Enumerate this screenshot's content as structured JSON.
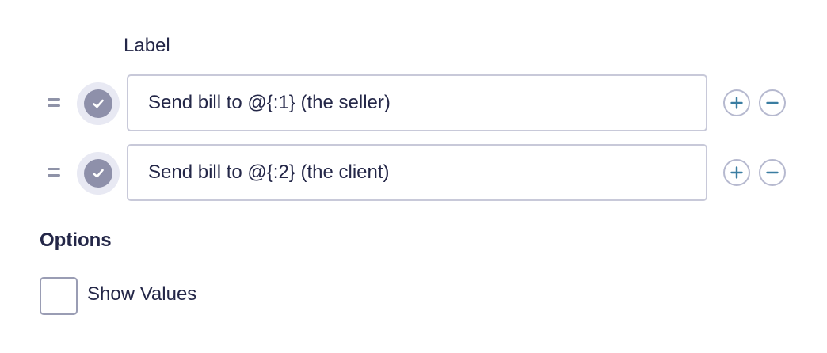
{
  "choices": {
    "header_label": "Label",
    "items": [
      {
        "value": "Send bill to @{:1} (the seller)",
        "checked": true,
        "drag_icon": "drag-handle-icon",
        "check_icon": "checkmark-icon",
        "add_icon": "plus-icon",
        "remove_icon": "minus-icon"
      },
      {
        "value": "Send bill to @{:2} (the client)",
        "checked": true,
        "drag_icon": "drag-handle-icon",
        "check_icon": "checkmark-icon",
        "add_icon": "plus-icon",
        "remove_icon": "minus-icon"
      }
    ]
  },
  "options": {
    "title": "Options",
    "show_values": {
      "label": "Show Values",
      "checked": false
    }
  },
  "colors": {
    "text": "#242748",
    "check_fill": "#8e90aa",
    "check_halo": "#e8e9f3",
    "input_border": "#c8c9d9",
    "button_border": "#b6b9cf",
    "button_glyph": "#3a7da1",
    "drag_handle": "#8f93a8"
  }
}
